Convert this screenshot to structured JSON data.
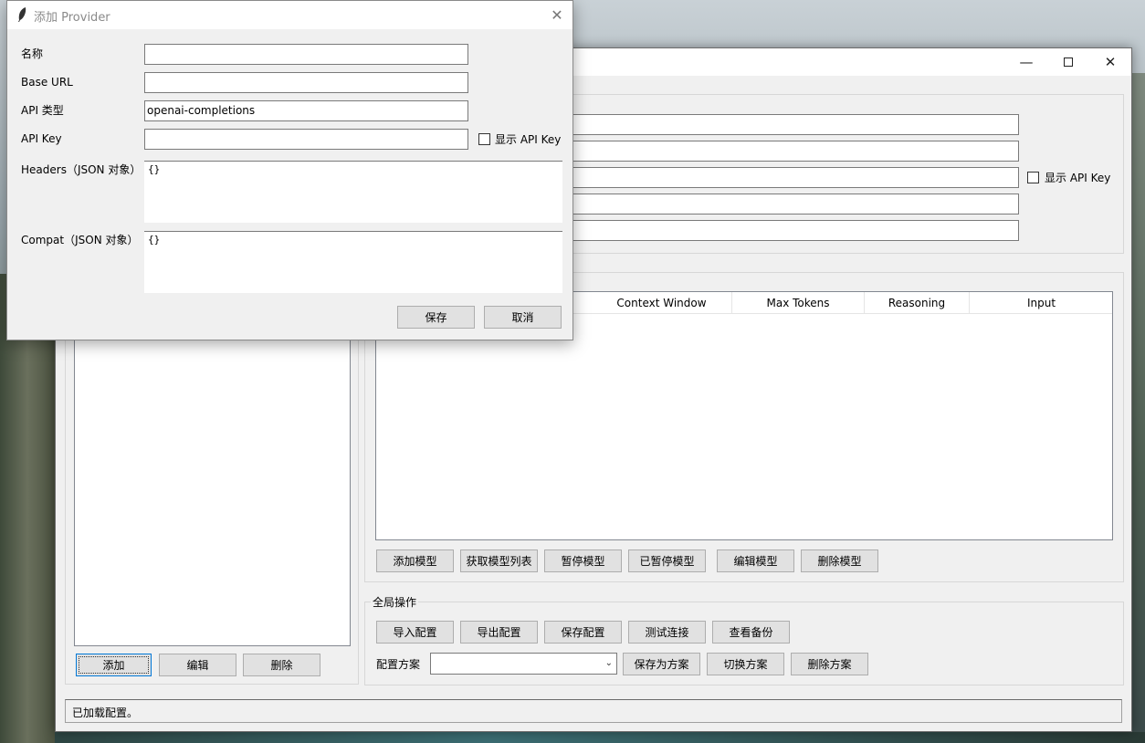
{
  "main_window": {
    "show_api_key_label": "显示 API Key",
    "model_table": {
      "columns": [
        "Context Window",
        "Max Tokens",
        "Reasoning",
        "Input"
      ]
    },
    "model_buttons": [
      "添加模型",
      "获取模型列表",
      "暂停模型",
      "已暂停模型",
      "编辑模型",
      "删除模型"
    ],
    "provider_buttons": [
      "添加",
      "编辑",
      "删除"
    ],
    "global_ops": {
      "title": "全局操作",
      "buttons": [
        "导入配置",
        "导出配置",
        "保存配置",
        "测试连接",
        "查看备份"
      ],
      "profile_label": "配置方案",
      "profile_value": "",
      "profile_buttons": [
        "保存为方案",
        "切换方案",
        "删除方案"
      ]
    },
    "status": "已加载配置。"
  },
  "dialog": {
    "title": "添加 Provider",
    "fields": {
      "name_label": "名称",
      "name_value": "",
      "base_url_label": "Base URL",
      "base_url_value": "",
      "api_type_label": "API 类型",
      "api_type_value": "openai-completions",
      "api_key_label": "API Key",
      "api_key_value": "",
      "show_api_key_label": "显示 API Key",
      "headers_label": "Headers（JSON 对象）",
      "headers_value": "{}",
      "compat_label": "Compat（JSON 对象）",
      "compat_value": "{}"
    },
    "save_label": "保存",
    "cancel_label": "取消"
  }
}
